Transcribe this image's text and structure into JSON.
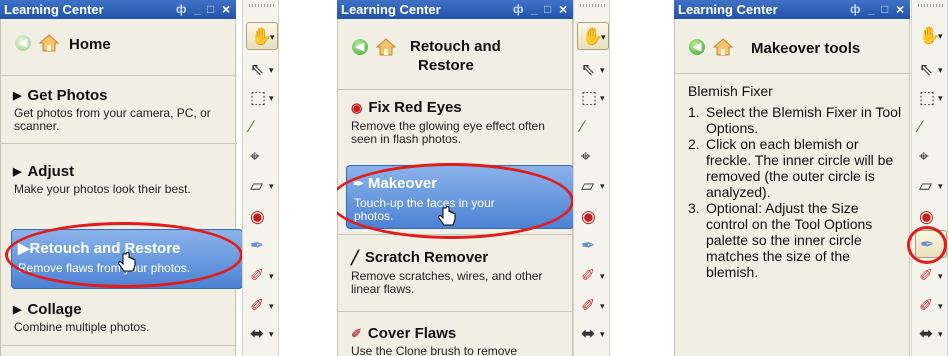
{
  "window": {
    "title": "Learning Center",
    "pin": "ф",
    "minimize": "_",
    "maximize": "□",
    "close": "×"
  },
  "icons": {
    "back": "back-arrow-icon",
    "home": "home-icon",
    "hand_cursor": "hand-cursor-icon"
  },
  "colors": {
    "titlebar": "#2d5cb4",
    "selection": "#5b8edb",
    "highlight_oval": "#e21b1b",
    "panel_bg": "#f1efe4"
  },
  "panel1": {
    "header": "Home",
    "items": [
      {
        "title": "Get Photos",
        "desc": "Get photos from your camera, PC, or scanner."
      },
      {
        "title": "Adjust",
        "desc": "Make your photos look their best."
      },
      {
        "title": "Retouch and Restore",
        "desc": "Remove flaws from your photos."
      },
      {
        "title": "Collage",
        "desc": "Combine multiple photos."
      }
    ]
  },
  "panel2": {
    "header_line1": "Retouch and",
    "header_line2": "Restore",
    "items": [
      {
        "title": "Fix Red Eyes",
        "desc": "Remove the glowing eye effect often seen in flash photos."
      },
      {
        "title": "Makeover",
        "desc": "Touch-up the faces in your photos."
      },
      {
        "title": "Scratch Remover",
        "desc": "Remove scratches, wires, and other linear flaws."
      },
      {
        "title": "Cover Flaws",
        "desc": "Use the Clone brush to remove"
      }
    ]
  },
  "panel3": {
    "header": "Makeover tools",
    "section_title": "Blemish Fixer",
    "steps": [
      {
        "num": "1.",
        "text": "Select the Blemish Fixer in Tool Options."
      },
      {
        "num": "2.",
        "text": "Click on each blemish or freckle. The inner circle will be removed (the outer circle is analyzed)."
      },
      {
        "num": "3.",
        "text": "Optional: Adjust the Size control on the Tool Options palette so the inner circle matches the size of the blemish."
      }
    ]
  },
  "toolbar": {
    "tools": [
      "pan-tool-icon",
      "selection-arrow-icon",
      "marquee-select-icon",
      "eyedropper-icon",
      "crop-icon",
      "straighten-icon",
      "red-eye-icon",
      "makeover-brush-icon",
      "clone-brush-icon",
      "paint-brush-icon",
      "more-tools-icon"
    ],
    "dropdown_arrow": "▾"
  }
}
